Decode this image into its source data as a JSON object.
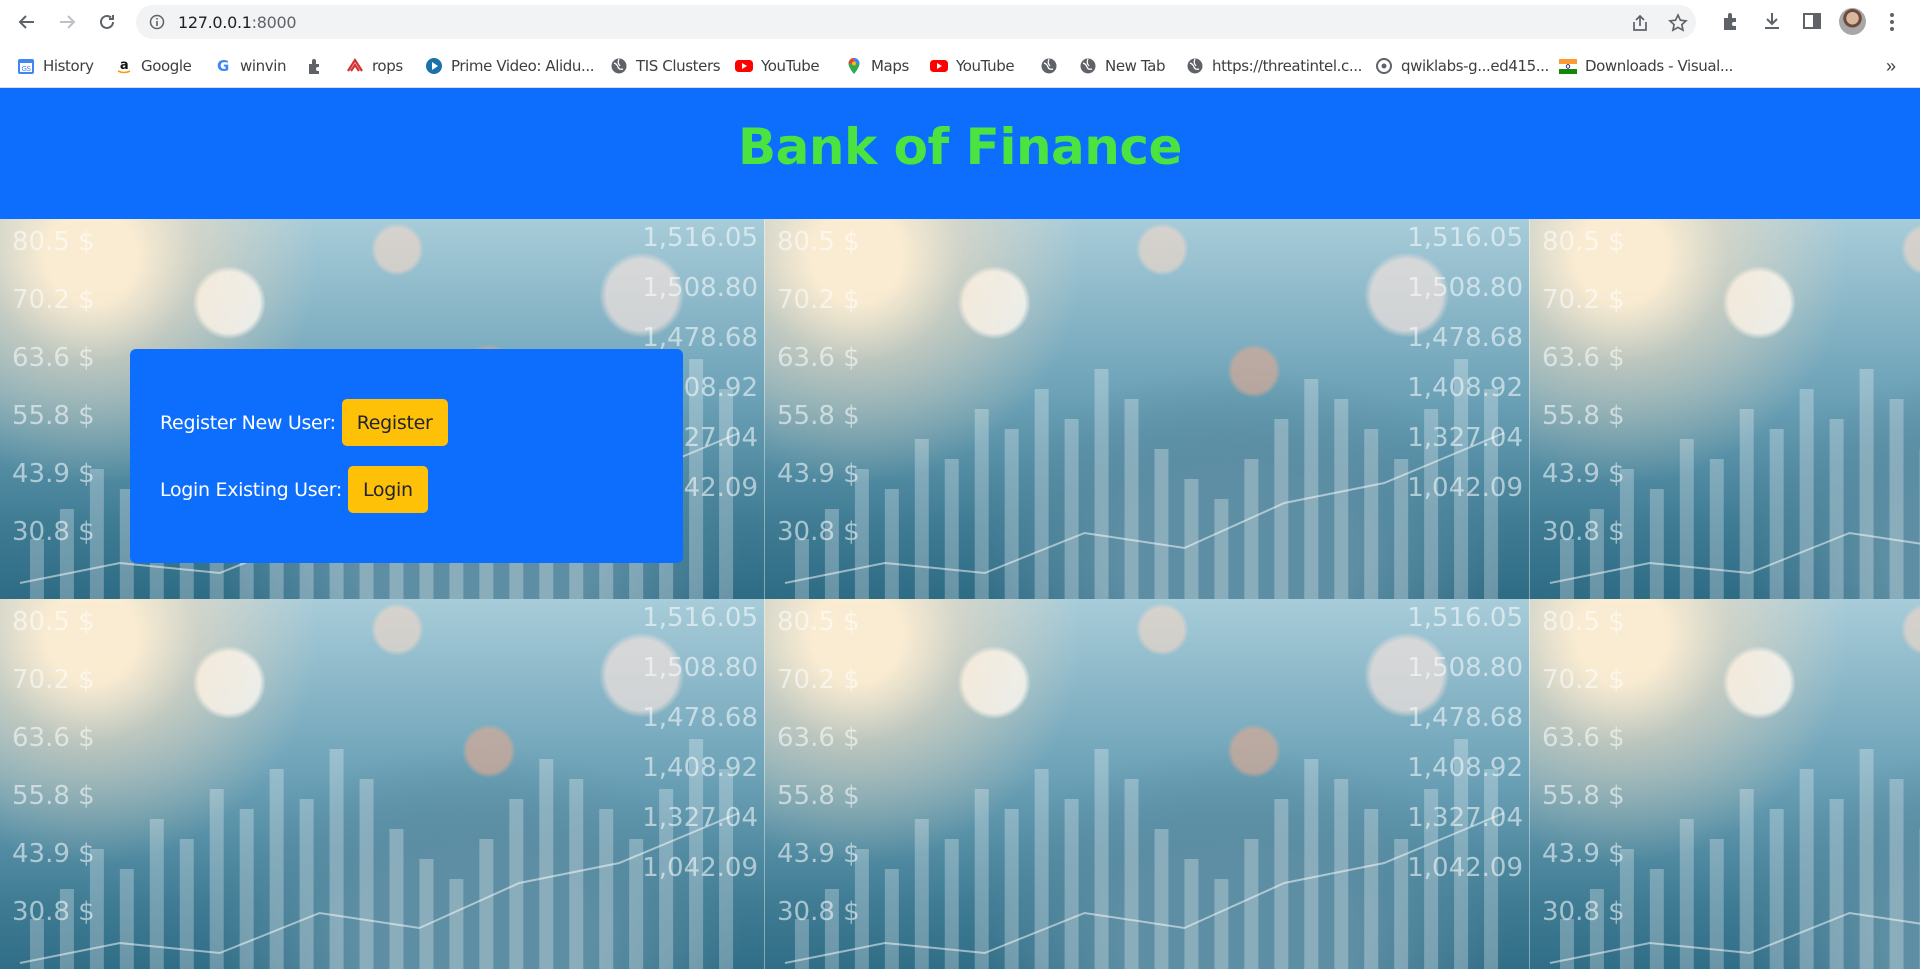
{
  "browser": {
    "url_host": "127.0.0.1",
    "url_port": ":8000",
    "bookmarks": [
      {
        "label": "History",
        "icon": "google-calendar-icon"
      },
      {
        "label": "Google",
        "icon": "amazon-icon"
      },
      {
        "label": "winvin",
        "icon": "google-icon"
      },
      {
        "label": "",
        "icon": "extension-puzzle-icon"
      },
      {
        "label": "rops",
        "icon": "rops-icon"
      },
      {
        "label": "Prime Video: Alidu...",
        "icon": "prime-video-icon"
      },
      {
        "label": "TIS Clusters",
        "icon": "globe-icon"
      },
      {
        "label": "YouTube",
        "icon": "youtube-icon"
      },
      {
        "label": "Maps",
        "icon": "maps-icon"
      },
      {
        "label": "YouTube",
        "icon": "youtube-icon"
      },
      {
        "label": "",
        "icon": "globe-icon"
      },
      {
        "label": "New Tab",
        "icon": "globe-icon"
      },
      {
        "label": "https://threatintel.c...",
        "icon": "globe-icon"
      },
      {
        "label": "qwiklabs-g...ed415...",
        "icon": "chrome-settings-icon"
      },
      {
        "label": "Downloads - Visual...",
        "icon": "india-flag-icon"
      }
    ],
    "more_bookmarks": "»"
  },
  "page": {
    "title": "Bank of Finance",
    "register_label": "Register New User:",
    "register_button": "Register",
    "login_label": "Login Existing User:",
    "login_button": "Login"
  },
  "background_numbers": [
    "80.5 $",
    "70.2 $",
    "63.6 $",
    "55.8 $",
    "43.9 $",
    "30.8 $",
    "1,516.05",
    "1,508.80",
    "1,478.68",
    "1,408.92",
    "1,327.04",
    "1,042.09"
  ],
  "colors": {
    "banner": "#0d6efd",
    "title": "#4be33f",
    "button": "#ffc107",
    "card": "#0d6efd"
  }
}
